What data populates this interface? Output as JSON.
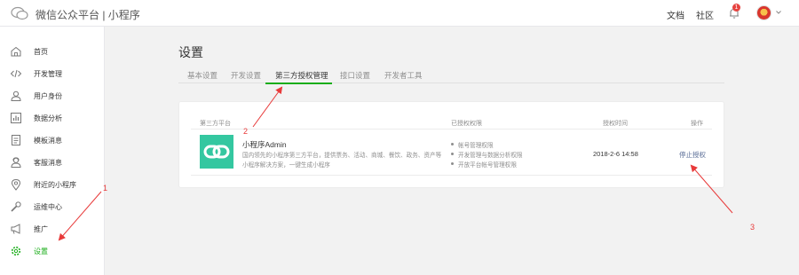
{
  "header": {
    "app_title": "微信公众平台 | 小程序",
    "links": [
      "文档",
      "社区"
    ],
    "notification_count": "1"
  },
  "sidebar": {
    "items": [
      {
        "label": "首页",
        "icon": "home-icon"
      },
      {
        "label": "开发管理",
        "icon": "code-icon"
      },
      {
        "label": "用户身份",
        "icon": "user-icon"
      },
      {
        "label": "数据分析",
        "icon": "chart-icon"
      },
      {
        "label": "模板消息",
        "icon": "document-icon"
      },
      {
        "label": "客服消息",
        "icon": "customer-service-icon"
      },
      {
        "label": "附近的小程序",
        "icon": "location-icon"
      },
      {
        "label": "运维中心",
        "icon": "wrench-icon"
      },
      {
        "label": "推广",
        "icon": "megaphone-icon"
      },
      {
        "label": "设置",
        "icon": "gear-icon",
        "active": true
      }
    ]
  },
  "main": {
    "title": "设置",
    "tabs": [
      {
        "label": "基本设置"
      },
      {
        "label": "开发设置"
      },
      {
        "label": "第三方授权管理",
        "active": true
      },
      {
        "label": "接口设置"
      },
      {
        "label": "开发者工具"
      }
    ],
    "table": {
      "headers": [
        "第三方平台",
        "已授权权限",
        "授权时间",
        "操作"
      ],
      "rows": [
        {
          "name": "小程序Admin",
          "description": "国内领先的小程序第三方平台，提供票务、活动、商城、餐饮、政务、资产等小程序解决方案，一键生成小程序",
          "permissions": [
            "帐号管理权限",
            "开发管理与数据分析权限",
            "开放平台帐号管理权限"
          ],
          "auth_time": "2018-2-6 14:58",
          "action": "停止授权"
        }
      ]
    }
  },
  "annotations": [
    "1",
    "2",
    "3"
  ],
  "colors": {
    "accent": "#1aad19",
    "link": "#576b95",
    "annotation": "#e83a3a",
    "app_logo": "#34c7a0"
  }
}
